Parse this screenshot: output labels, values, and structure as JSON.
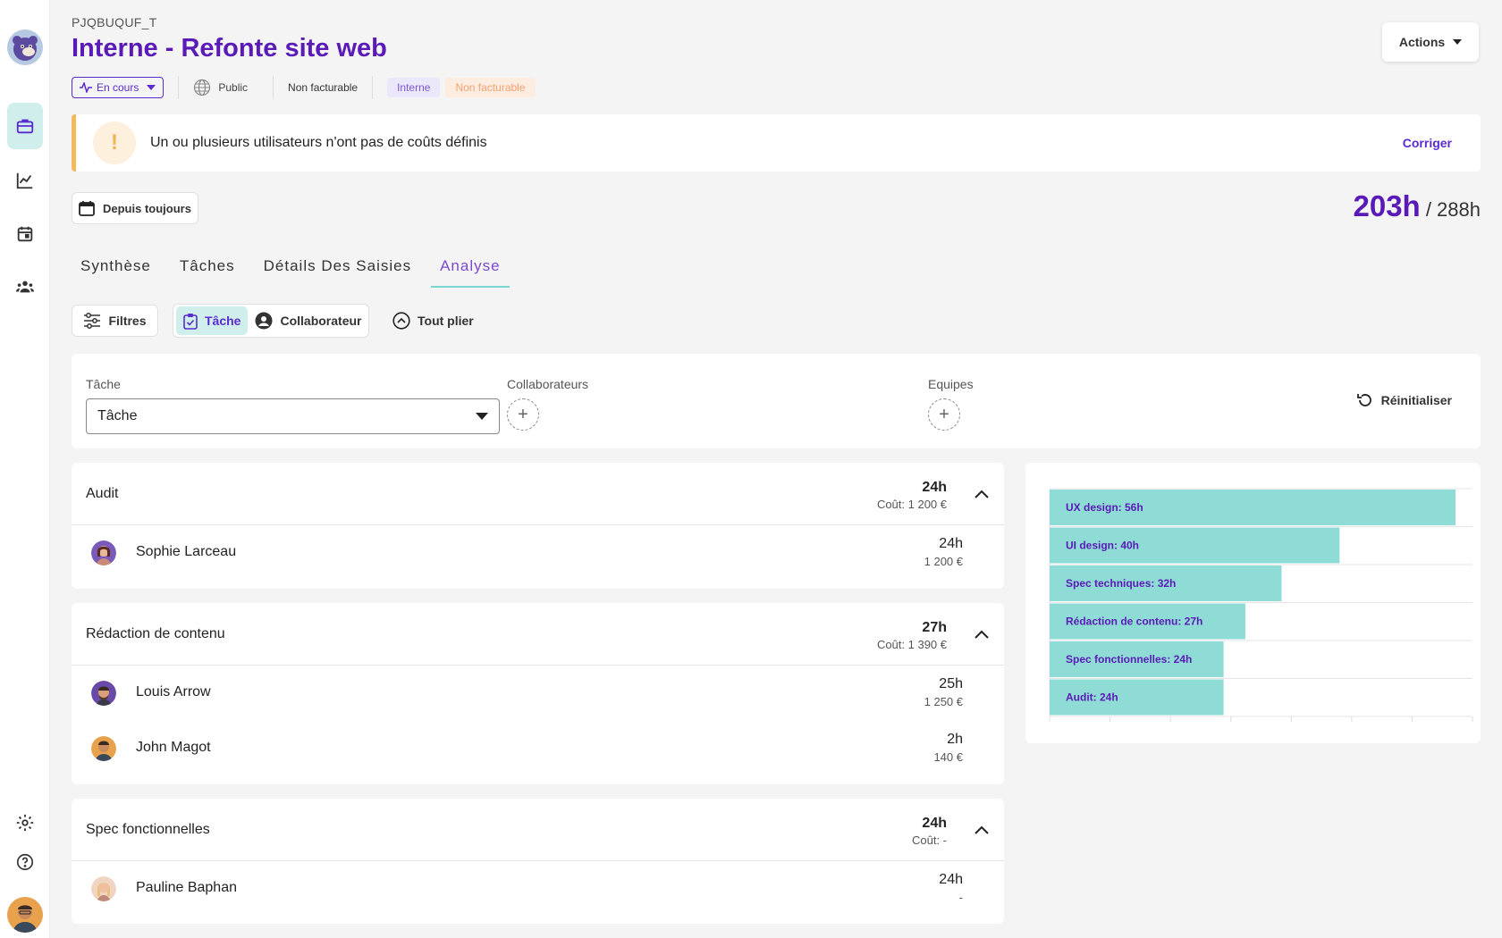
{
  "project": {
    "code": "PJQBUQUF_T",
    "title": "Interne - Refonte site web",
    "actions_label": "Actions"
  },
  "tags": {
    "status": "En cours",
    "visibility": "Public",
    "billing": "Non facturable",
    "chip_interne": "Interne",
    "chip_billing": "Non facturable"
  },
  "alert": {
    "text": "Un ou plusieurs utilisateurs n'ont pas de coûts définis",
    "link": "Corriger",
    "icon": "!"
  },
  "period": {
    "label": "Depuis toujours"
  },
  "totals": {
    "done": "203h",
    "planned": "/ 288h"
  },
  "tabs": [
    {
      "label": "Synthèse"
    },
    {
      "label": "Tâches"
    },
    {
      "label": "Détails Des Saisies"
    },
    {
      "label": "Analyse"
    }
  ],
  "toolbar": {
    "filters": "Filtres",
    "group_task": "Tâche",
    "group_collab": "Collaborateur",
    "collapse_all": "Tout plier"
  },
  "filters": {
    "task_label": "Tâche",
    "task_value": "Tâche",
    "collab_label": "Collaborateurs",
    "teams_label": "Equipes",
    "reset": "Réinitialiser"
  },
  "groups": [
    {
      "name": "Audit",
      "hours": "24h",
      "cost": "Coût: 1 200 €",
      "rows": [
        {
          "name": "Sophie Larceau",
          "hours": "24h",
          "cost": "1 200 €"
        }
      ]
    },
    {
      "name": "Rédaction de contenu",
      "hours": "27h",
      "cost": "Coût: 1 390 €",
      "rows": [
        {
          "name": "Louis Arrow",
          "hours": "25h",
          "cost": "1 250 €"
        },
        {
          "name": "John Magot",
          "hours": "2h",
          "cost": "140 €"
        }
      ]
    },
    {
      "name": "Spec fonctionnelles",
      "hours": "24h",
      "cost": "Coût: -",
      "rows": [
        {
          "name": "Pauline Baphan",
          "hours": "24h",
          "cost": "-"
        }
      ]
    }
  ],
  "chart_data": {
    "type": "bar",
    "orientation": "horizontal",
    "categories": [
      "UX design",
      "UI design",
      "Spec techniques",
      "Rédaction de contenu",
      "Spec fonctionnelles",
      "Audit"
    ],
    "values": [
      56,
      40,
      32,
      27,
      24,
      24
    ],
    "labels": [
      "UX design: 56h",
      "UI design: 40h",
      "Spec techniques: 32h",
      "Rédaction de contenu: 27h",
      "Spec fonctionnelles: 24h",
      "Audit: 24h"
    ],
    "xlim": [
      0,
      70
    ],
    "bar_color": "#8fdcd6",
    "label_color": "#5a1ab8",
    "grid": true
  },
  "colors": {
    "accent": "#5a1ab8",
    "teal": "#cfeeec",
    "warning": "#f5b95b"
  }
}
